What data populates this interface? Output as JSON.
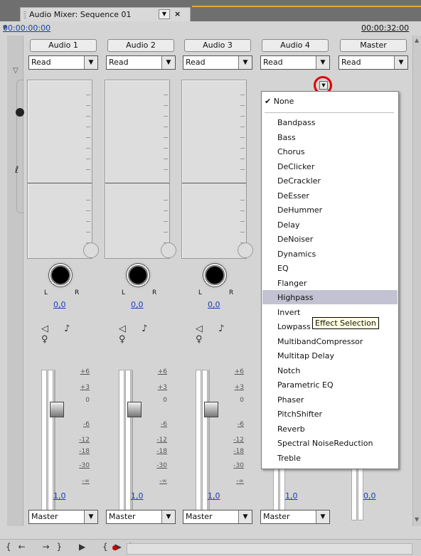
{
  "tab": {
    "title": "Audio Mixer: Sequence 01",
    "dropdown_icon": "chevron-down-icon",
    "close": "×"
  },
  "time": {
    "current": "00:00:00:00",
    "end": "00:00:32:00"
  },
  "tracks": [
    {
      "name": "Audio 1",
      "automation": "Read",
      "pan_left": "L",
      "pan_right": "R",
      "pan_value": "0,0",
      "volume_value": "1,0",
      "output": "Master"
    },
    {
      "name": "Audio 2",
      "automation": "Read",
      "pan_left": "L",
      "pan_right": "R",
      "pan_value": "0,0",
      "volume_value": "1,0",
      "output": "Master"
    },
    {
      "name": "Audio 3",
      "automation": "Read",
      "pan_left": "L",
      "pan_right": "R",
      "pan_value": "0,0",
      "volume_value": "1,0",
      "output": "Master"
    },
    {
      "name": "Audio 4",
      "automation": "Read",
      "volume_value": "1,0",
      "output": "Master"
    },
    {
      "name": "Master",
      "automation": "Read",
      "volume_value": "0,0"
    }
  ],
  "scale": [
    "+6",
    "+3",
    "0",
    "-6",
    "-12",
    "-18",
    "-30",
    "-∞"
  ],
  "track_buttons": [
    "◁",
    "♪",
    "♀"
  ],
  "menu": {
    "checked": "None",
    "items": [
      "Bandpass",
      "Bass",
      "Chorus",
      "DeClicker",
      "DeCrackler",
      "DeEsser",
      "DeHummer",
      "Delay",
      "DeNoiser",
      "Dynamics",
      "EQ",
      "Flanger",
      "Highpass",
      "Invert",
      "Lowpass",
      "MultibandCompressor",
      "Multitap Delay",
      "Notch",
      "Parametric EQ",
      "Phaser",
      "PitchShifter",
      "Reverb",
      "Spectral NoiseReduction",
      "Treble"
    ],
    "highlighted": "Highpass"
  },
  "tooltip": "Effect Selection",
  "transport": "{← →} ▶ {▶} ⊡",
  "colors": {
    "link": "#1a3db0",
    "highlight": "#c2c2d2",
    "annotation_circle": "#e00000",
    "tab_accent": "#e8a838"
  }
}
